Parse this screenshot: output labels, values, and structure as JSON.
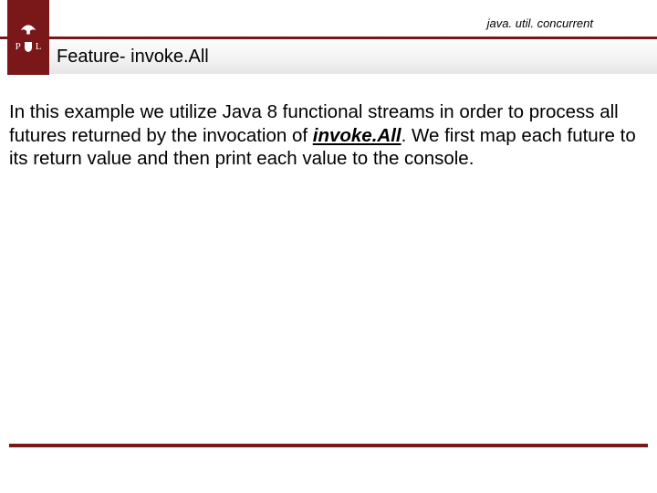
{
  "header": {
    "package": "java. util. concurrent",
    "logo": {
      "left_letter": "P",
      "right_letter": "L"
    },
    "title": "Feature- invoke.All"
  },
  "body": {
    "part1": "In this example we utilize Java 8 functional streams in order to process all futures returned by the invocation of ",
    "emph": "invoke.All",
    "part2": ". We first map each future to its return value and then print each value to the console."
  },
  "colors": {
    "brand": "#7a1719"
  }
}
